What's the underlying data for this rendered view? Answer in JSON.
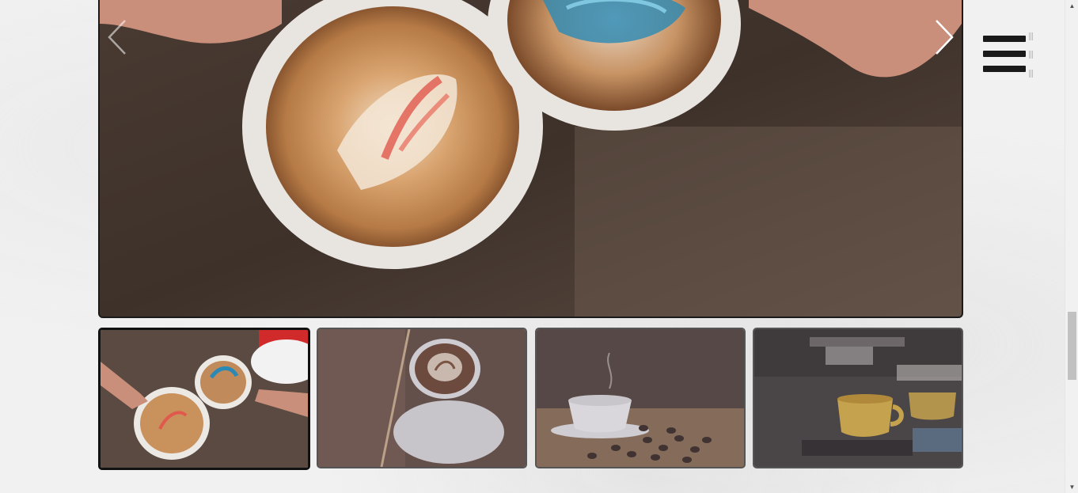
{
  "slider": {
    "active_index": 0,
    "main_image": "latte-art-two-cups-photo",
    "prev_icon": "chevron-left-icon",
    "next_icon": "chevron-right-icon"
  },
  "menu": {
    "icon": "hamburger-menu-icon"
  },
  "thumbnails": [
    {
      "image": "two-latte-cups-hands-photo",
      "active": true
    },
    {
      "image": "cappuccino-cup-on-saucer-photo",
      "active": false
    },
    {
      "image": "white-cup-coffee-beans-photo",
      "active": false
    },
    {
      "image": "espresso-machine-yellow-cup-photo",
      "active": false
    }
  ],
  "scrollbar": {
    "up_icon": "scroll-up-icon",
    "down_icon": "scroll-down-icon"
  },
  "colors": {
    "frame": "#1a1a1a",
    "background": "#f1f1f1",
    "scroll_thumb": "#c1c1c1"
  }
}
